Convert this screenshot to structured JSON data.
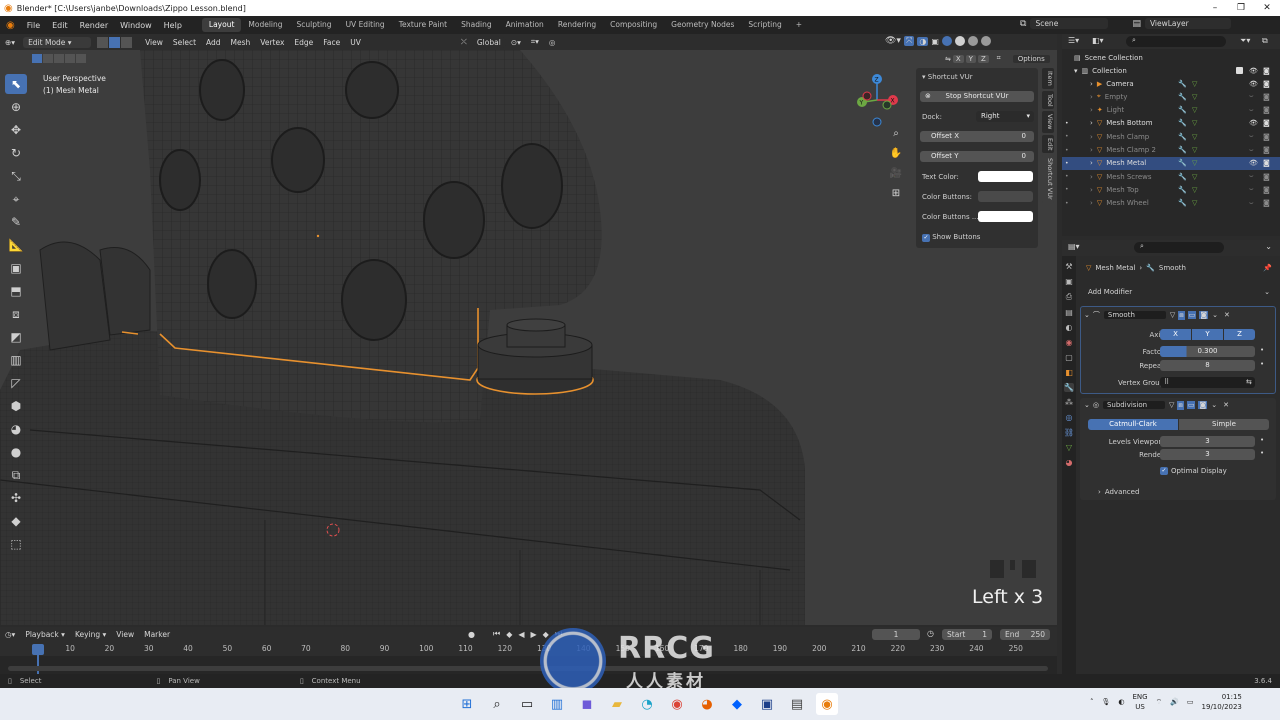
{
  "title_bar": {
    "text": "Blender* [C:\\Users\\janbe\\Downloads\\Zippo Lesson.blend]",
    "controls": [
      "–",
      "❐",
      "✕"
    ]
  },
  "top_menu": [
    "File",
    "Edit",
    "Render",
    "Window",
    "Help"
  ],
  "workspaces": [
    "Layout",
    "Modeling",
    "Sculpting",
    "UV Editing",
    "Texture Paint",
    "Shading",
    "Animation",
    "Rendering",
    "Compositing",
    "Geometry Nodes",
    "Scripting"
  ],
  "active_workspace": "Layout",
  "scene_name": "Scene",
  "view_layer": "ViewLayer",
  "viewport_header": {
    "mode": "Edit Mode",
    "menus": [
      "View",
      "Select",
      "Add",
      "Mesh",
      "Vertex",
      "Edge",
      "Face",
      "UV"
    ],
    "transform_orientation": "Global",
    "options_label": "Options",
    "axis_labels": [
      "X",
      "Y",
      "Z"
    ]
  },
  "viewport_info": {
    "line1": "User Perspective",
    "line2": "(1) Mesh Metal"
  },
  "n_panel": {
    "title": "Shortcut VUr",
    "stop_button": "Stop Shortcut VUr",
    "dock_label": "Dock:",
    "dock_value": "Right",
    "offset_x_label": "Offset X",
    "offset_x_value": "0",
    "offset_y_label": "Offset Y",
    "offset_y_value": "0",
    "text_color_label": "Text Color:",
    "color_buttons_label": "Color Buttons:",
    "color_buttons2_label": "Color Buttons ...",
    "show_buttons_label": "Show Buttons",
    "show_buttons_checked": true
  },
  "side_tabs": [
    "Item",
    "Tool",
    "View",
    "Edit",
    "Shortcut VUr"
  ],
  "gizmo_axes": {
    "x": "X",
    "y": "Y",
    "z": "Z",
    "x_color": "#e0394b",
    "y_color": "#6ca843",
    "z_color": "#3d89d8"
  },
  "shortcut_display": "Left x 3",
  "timeline": {
    "menus": [
      "Playback",
      "Keying",
      "View",
      "Marker"
    ],
    "current_frame": "1",
    "start_label": "Start",
    "start_value": "1",
    "end_label": "End",
    "end_value": "250",
    "ticks": [
      "1",
      "10",
      "20",
      "30",
      "40",
      "50",
      "60",
      "70",
      "80",
      "90",
      "100",
      "110",
      "120",
      "130",
      "140",
      "150",
      "160",
      "170",
      "180",
      "190",
      "200",
      "210",
      "220",
      "230",
      "240",
      "250"
    ]
  },
  "status_bar": {
    "select": "Select",
    "pan": "Pan View",
    "context": "Context Menu",
    "version": "3.6.4"
  },
  "outliner": {
    "root": "Scene Collection",
    "collection": "Collection",
    "items": [
      {
        "name": "Camera",
        "dim": false,
        "selected": false
      },
      {
        "name": "Empty",
        "dim": true,
        "selected": false
      },
      {
        "name": "Light",
        "dim": true,
        "selected": false
      },
      {
        "name": "Mesh Bottom",
        "dim": false,
        "selected": false
      },
      {
        "name": "Mesh Clamp",
        "dim": true,
        "selected": false
      },
      {
        "name": "Mesh Clamp 2",
        "dim": true,
        "selected": false
      },
      {
        "name": "Mesh Metal",
        "dim": false,
        "selected": true
      },
      {
        "name": "Mesh Screws",
        "dim": true,
        "selected": false
      },
      {
        "name": "Mesh Top",
        "dim": true,
        "selected": false
      },
      {
        "name": "Mesh Wheel",
        "dim": true,
        "selected": false
      }
    ]
  },
  "properties": {
    "breadcrumb_object": "Mesh Metal",
    "breadcrumb_modifier": "Smooth",
    "add_modifier": "Add Modifier",
    "smooth": {
      "name": "Smooth",
      "axis_label": "Axis",
      "axis_buttons": [
        "X",
        "Y",
        "Z"
      ],
      "factor_label": "Factor",
      "factor_value": "0.300",
      "repeat_label": "Repeat",
      "repeat_value": "8",
      "vertex_group_label": "Vertex Group"
    },
    "subdivision": {
      "name": "Subdivision",
      "type_a": "Catmull-Clark",
      "type_b": "Simple",
      "levels_viewport_label": "Levels Viewport",
      "levels_viewport_value": "3",
      "render_label": "Render",
      "render_value": "3",
      "optimal_display": "Optimal Display",
      "advanced": "Advanced"
    }
  },
  "taskbar": {
    "lang": "ENG",
    "region": "US",
    "time": "01:15",
    "date": "19/10/2023"
  },
  "watermark": {
    "big": "RRCG",
    "small": "人人素材"
  },
  "colors": {
    "accent": "#4772b3",
    "selection_orange": "#e8912e",
    "outliner_selected": "#334d80"
  }
}
